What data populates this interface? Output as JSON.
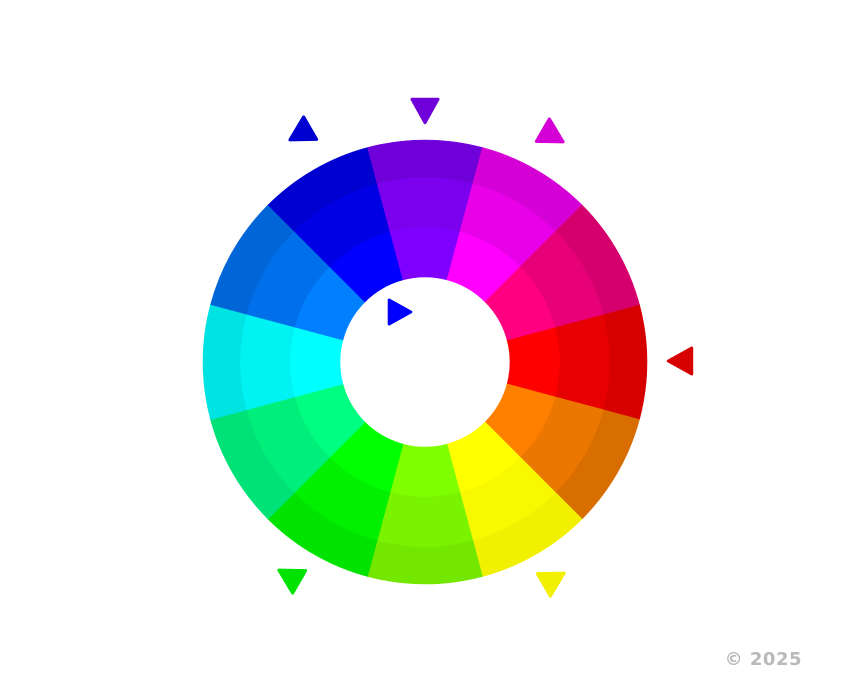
{
  "copyright": "© 2025",
  "wheel": {
    "segment_count": 12,
    "ring_count": 3,
    "segments": [
      {
        "name": "red",
        "rings": [
          "#FF0000",
          "#E60000",
          "#D70000"
        ]
      },
      {
        "name": "red-orange",
        "rings": [
          "#FF8000",
          "#EC7700",
          "#D86D00"
        ]
      },
      {
        "name": "yellow",
        "rings": [
          "#FFFF00",
          "#F8F800",
          "#F0F000"
        ]
      },
      {
        "name": "yellow-green",
        "rings": [
          "#80FF00",
          "#7AF300",
          "#74E700"
        ]
      },
      {
        "name": "green",
        "rings": [
          "#00FF00",
          "#00F000",
          "#00E300"
        ]
      },
      {
        "name": "blue-green",
        "rings": [
          "#00FF80",
          "#00EF7B",
          "#00E178"
        ]
      },
      {
        "name": "cyan",
        "rings": [
          "#00FFFF",
          "#00F2F2",
          "#00E3E3"
        ]
      },
      {
        "name": "blue-azure",
        "rings": [
          "#0080FF",
          "#0070EA",
          "#0066D8"
        ]
      },
      {
        "name": "blue",
        "rings": [
          "#0000FF",
          "#0000E4",
          "#0000D0"
        ]
      },
      {
        "name": "violet",
        "rings": [
          "#8000FF",
          "#7A00EE",
          "#7000D9"
        ]
      },
      {
        "name": "magenta",
        "rings": [
          "#FF00FF",
          "#E800E8",
          "#D500D5"
        ]
      },
      {
        "name": "red-violet",
        "rings": [
          "#FF0080",
          "#E80078",
          "#D5006E"
        ]
      }
    ]
  },
  "markers": [
    {
      "name": "marker-red",
      "color": "#D70000"
    },
    {
      "name": "marker-yellow",
      "color": "#F0F000"
    },
    {
      "name": "marker-green",
      "color": "#00E300"
    },
    {
      "name": "marker-blue",
      "color": "#0000D0"
    },
    {
      "name": "marker-violet",
      "color": "#7000D9"
    },
    {
      "name": "marker-magenta",
      "color": "#D500D5"
    },
    {
      "name": "marker-center-blue",
      "color": "#0000FF"
    }
  ]
}
